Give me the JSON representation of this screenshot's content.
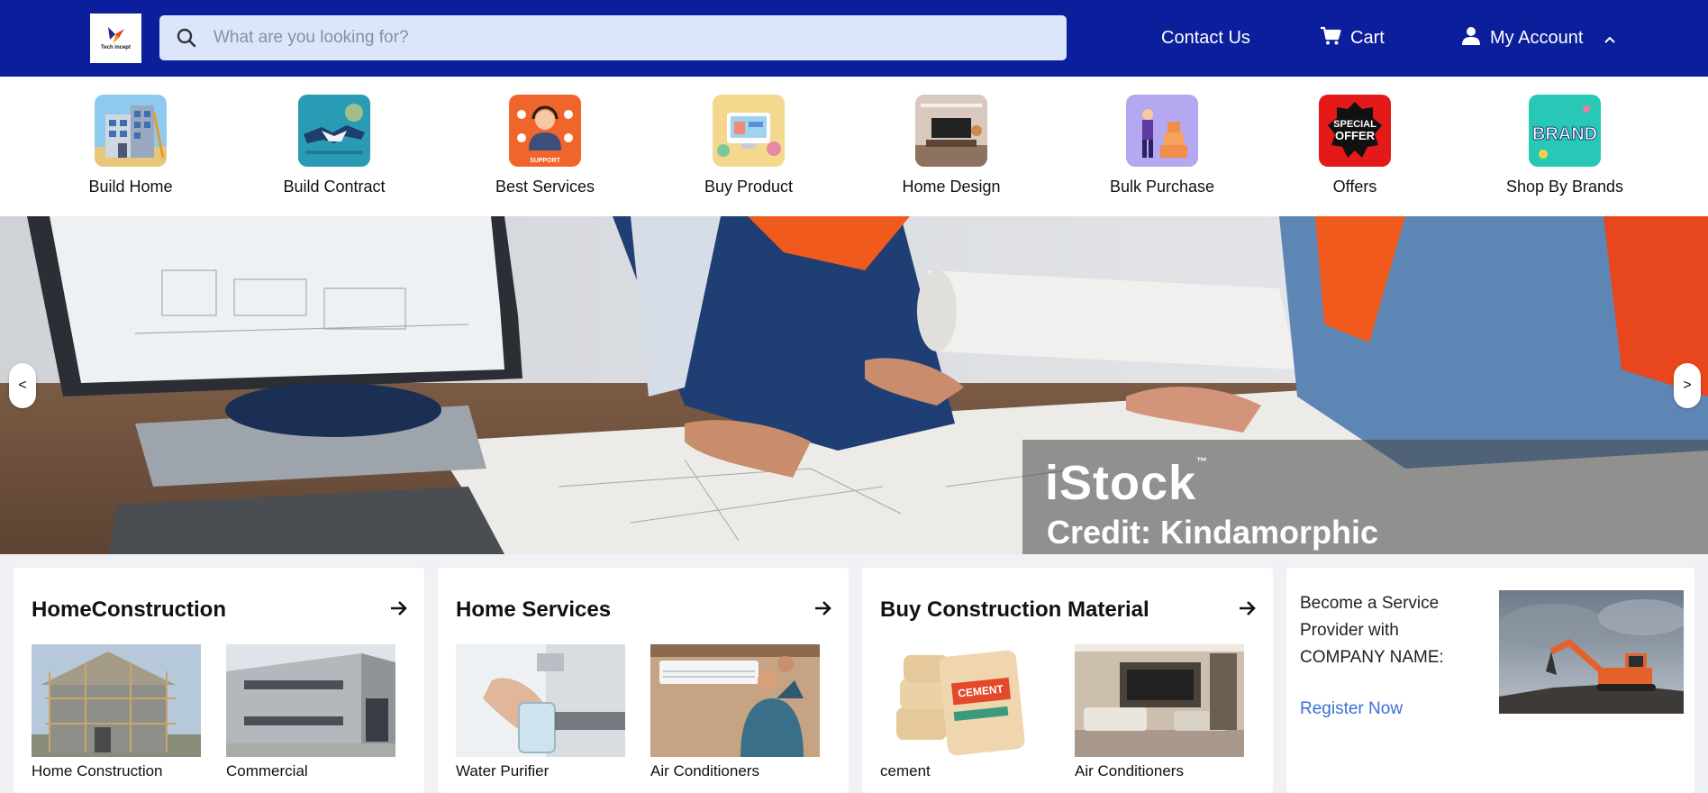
{
  "logo": {
    "text": "Tech incept"
  },
  "search": {
    "placeholder": "What are you looking for?"
  },
  "header": {
    "contact_label": "Contact Us",
    "cart_label": "Cart",
    "account_label": "My Account"
  },
  "categories": [
    {
      "label": "Build Home",
      "icon": "building-icon"
    },
    {
      "label": "Build Contract",
      "icon": "handshake-icon"
    },
    {
      "label": "Best Services",
      "icon": "support-agent-icon"
    },
    {
      "label": "Buy Product",
      "icon": "online-store-icon"
    },
    {
      "label": "Home Design",
      "icon": "living-room-icon"
    },
    {
      "label": "Bulk Purchase",
      "icon": "delivery-boxes-icon"
    },
    {
      "label": "Offers",
      "icon": "special-offer-icon"
    },
    {
      "label": "Shop By Brands",
      "icon": "brand-icon"
    }
  ],
  "category_badges": {
    "support": "SUPPORT",
    "offer_line1": "SPECIAL",
    "offer_line2": "OFFER",
    "brand": "BRAND"
  },
  "hero": {
    "watermark_brand": "iStock",
    "watermark_tm": "™",
    "watermark_credit": "Credit: Kindamorphic",
    "prev_label": "<",
    "next_label": ">"
  },
  "sections": [
    {
      "title": "HomeConstruction",
      "items": [
        {
          "caption": "Home Construction"
        },
        {
          "caption": "Commercial"
        }
      ]
    },
    {
      "title": "Home Services",
      "items": [
        {
          "caption": "Water Purifier"
        },
        {
          "caption": "Air Conditioners"
        }
      ]
    },
    {
      "title": "Buy Construction Material",
      "items": [
        {
          "caption": "cement"
        },
        {
          "caption": "Air Conditioners"
        }
      ]
    }
  ],
  "cement_bag_text": "CEMENT",
  "provider": {
    "text": "Become a Service Provider with COMPANY NAME:",
    "link": "Register Now"
  },
  "colors": {
    "header_bg": "#0b1f9c",
    "search_bg": "#dbe6fb",
    "link": "#3b6fd6"
  }
}
